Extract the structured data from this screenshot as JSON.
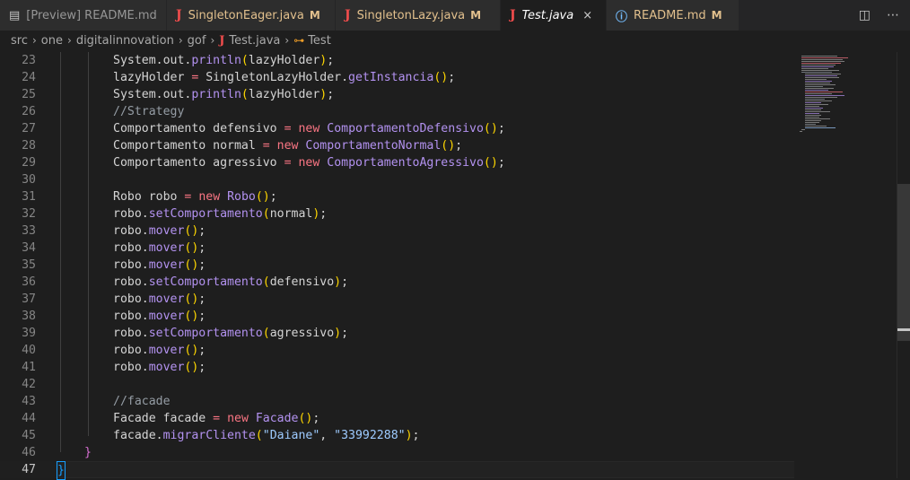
{
  "tabs": [
    {
      "label": "[Preview] README.md",
      "icon": "preview-icon",
      "status": ""
    },
    {
      "label": "SingletonEager.java",
      "icon": "java-icon",
      "status": "M"
    },
    {
      "label": "SingletonLazy.java",
      "icon": "java-icon",
      "status": "M"
    },
    {
      "label": "Test.java",
      "icon": "java-icon",
      "status": "",
      "close": "×"
    },
    {
      "label": "README.md",
      "icon": "info-icon",
      "status": "M"
    }
  ],
  "editor_actions": {
    "split": "◫",
    "more": "⋯"
  },
  "breadcrumb": {
    "items": [
      "src",
      "one",
      "digitalinnovation",
      "gof",
      "Test.java",
      "Test"
    ]
  },
  "code": {
    "line_numbers": [
      "23",
      "24",
      "25",
      "26",
      "27",
      "28",
      "29",
      "30",
      "31",
      "32",
      "33",
      "34",
      "35",
      "36",
      "37",
      "38",
      "39",
      "40",
      "41",
      "42",
      "43",
      "44",
      "45",
      "46",
      "47"
    ],
    "current_line": "47"
  },
  "colors": {
    "accent": "#179fff",
    "modified": "#e2c08d",
    "java": "#f14c4c"
  }
}
